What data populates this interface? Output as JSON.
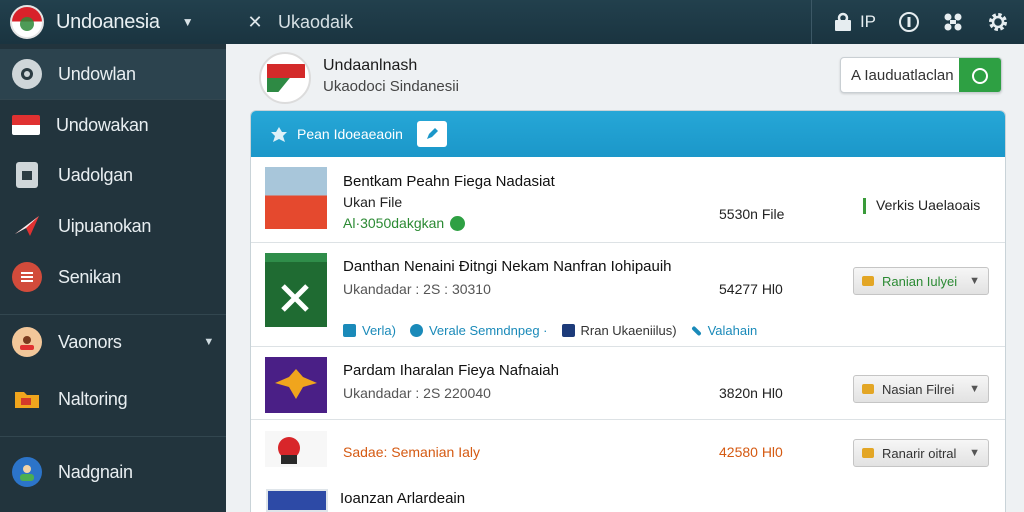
{
  "topbar": {
    "brand": "Undoanesia",
    "window_title": "Ukaodaik",
    "ip_label": "IP",
    "icons": [
      "shield-icon",
      "info-icon",
      "share-icon",
      "gear-icon"
    ]
  },
  "sidebar": {
    "items": [
      {
        "label": "Undowlan",
        "icon": "chat-icon"
      },
      {
        "label": "Undowakan",
        "icon": "flag-icon"
      },
      {
        "label": "Uadolgan",
        "icon": "document-icon"
      },
      {
        "label": "Uipuanokan",
        "icon": "paper-plane-icon"
      },
      {
        "label": "Senikan",
        "icon": "menu-icon"
      },
      {
        "label": "Vaonors",
        "icon": "person-icon"
      },
      {
        "label": "Naltoring",
        "icon": "folder-icon"
      },
      {
        "label": "Nadgnain",
        "icon": "avatar-icon"
      }
    ]
  },
  "header": {
    "title": "Undaanlnash",
    "subtitle": "Ukaodoci Sindanesii",
    "upload_label": "A Iauduatlaclan"
  },
  "panel": {
    "title": "Pean Idoeaeaoin",
    "rows": [
      {
        "title": "Bentkam Peahn Fiega Nadasiat",
        "subtitle": "Ukan File",
        "meta": "Al·3050dakgkan",
        "size": "5530n File",
        "status": "Verkis  Uaelaoais"
      },
      {
        "title": "Danthan Nenaini Ðitngi Nekam Nanfran Iohipauih",
        "meta": "Ukandadar :  2S : 30310",
        "size": "54277 Hl0",
        "action": "Ranian Iulyei",
        "links": [
          "Verla)",
          "Verale  Semndnpeg ·",
          "Rran Ukaeniilus)",
          "Valahain"
        ]
      },
      {
        "title": "Pardam Iharalan Fieya Nafnaiah",
        "meta": "Ukandadar : 2S 220040",
        "size": "3820n Hl0",
        "action": "Nasian Filrei"
      },
      {
        "title": "Sadae: Semanian Ialy",
        "size": "42580 Hl0",
        "action": "Ranarir oitral"
      }
    ]
  },
  "footer_item": {
    "title": "Ioanzan Arlardeain"
  }
}
